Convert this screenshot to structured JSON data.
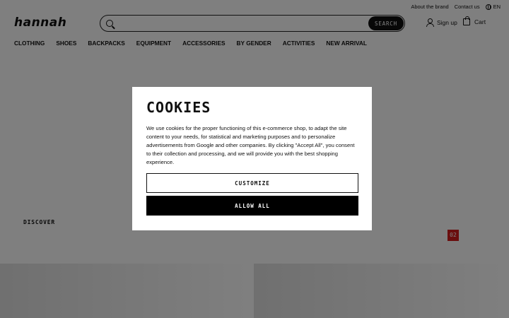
{
  "topbar": {
    "about": "About the brand",
    "contact": "Contact us",
    "language": "EN"
  },
  "logo": "hannah",
  "search": {
    "placeholder": "",
    "button": "SEARCH"
  },
  "account": {
    "signup": "Sign up",
    "cart": "Cart"
  },
  "nav": [
    "CLOTHING",
    "SHOES",
    "BACKPACKS",
    "EQUIPMENT",
    "ACCESSORIES",
    "BY GENDER",
    "ACTIVITIES",
    "NEW ARRIVAL"
  ],
  "page": {
    "discover": "DISCOVER",
    "counter": "02"
  },
  "cookies": {
    "title": "COOKIES",
    "text": "We use cookies for the proper functioning of this e-commerce shop, to adapt the site content to your needs, for statistical and marketing purposes and to personalize advertisements from Google and other companies. By clicking \"Accept All\", you consent to their collection and processing, and we will provide you with the best shopping experience.",
    "customize": "CUSTOMIZE",
    "allow_all": "ALLOW ALL"
  },
  "colors": {
    "accent": "#d41c1c",
    "overlay": "rgba(0,0,0,0.5)"
  }
}
